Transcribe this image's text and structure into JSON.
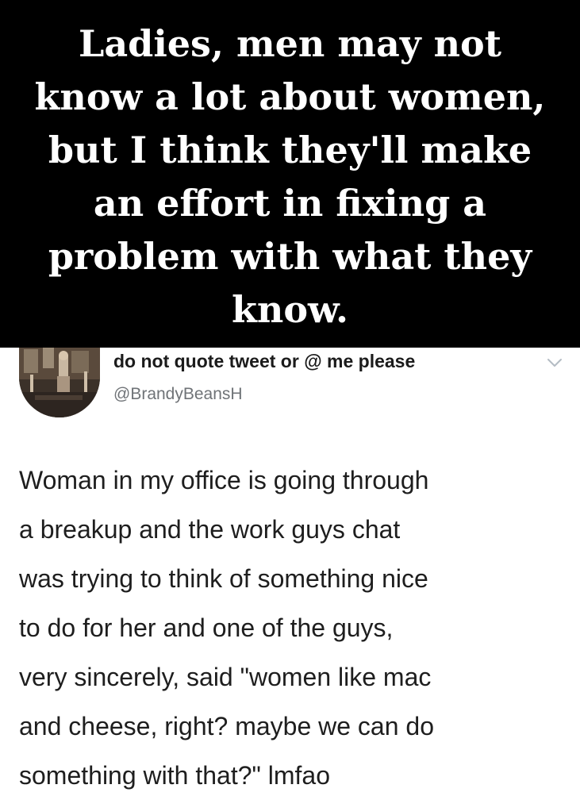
{
  "caption": {
    "lines": [
      "Ladies, men may not",
      "know a lot about women,",
      "but I think they'll make",
      "an effort in fixing a",
      "problem with what they",
      "know."
    ]
  },
  "tweet": {
    "display_name": "do not quote tweet or @ me please",
    "handle": "@BrandyBeansH",
    "avatar_icon": "profile-photo",
    "menu_icon": "chevron-down-icon",
    "body_lines": [
      "Woman in my office is going through",
      "a breakup and the work guys chat",
      "was trying to think of something nice",
      "to do for her and one of the guys,",
      "very sincerely, said \"women like mac",
      "and cheese, right? maybe we can do",
      "something with that?\" lmfao"
    ]
  },
  "colors": {
    "caption_background": "#000000",
    "caption_text": "#ffffff",
    "tweet_background": "#ffffff",
    "tweet_text": "#1e1e1e",
    "handle_text": "#6f7377",
    "chevron": "#b4bcc4"
  }
}
